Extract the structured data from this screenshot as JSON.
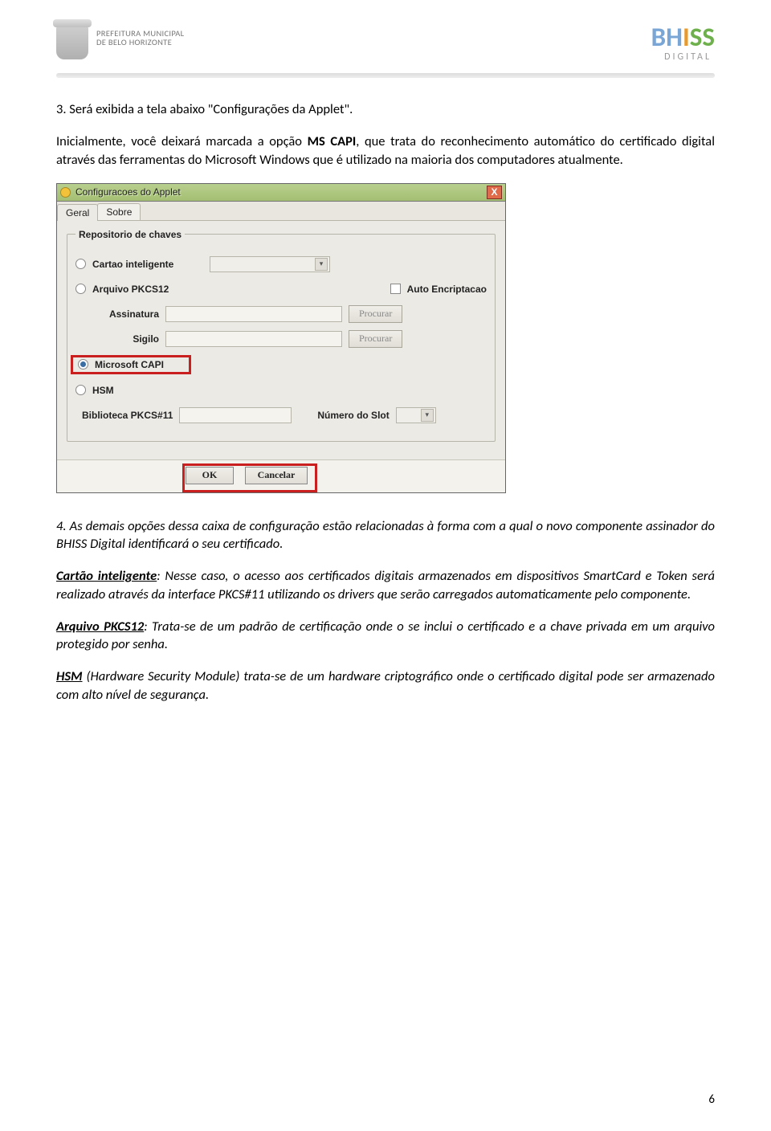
{
  "header": {
    "prefeitura_l1": "PREFEITURA MUNICIPAL",
    "prefeitura_l2": "DE BELO HORIZONTE",
    "bhiss_b": "B",
    "bhiss_h": "H",
    "bhiss_i": "I",
    "bhiss_s1": "S",
    "bhiss_s2": "S",
    "bhiss_sub": "DIGITAL"
  },
  "p3": "3.  Será exibida a tela abaixo \"Configurações da Applet\".",
  "p3b_a": "Inicialmente, você deixará marcada a opção ",
  "p3b_bold": "MS CAPI",
  "p3b_b": ", que trata do reconhecimento automático do certificado digital através das ferramentas do Microsoft Windows que é utilizado na maioria dos computadores atualmente.",
  "p4": "4. As demais opções dessa caixa de configuração estão relacionadas à forma com a qual o novo componente assinador do BHISS Digital identificará o seu certificado.",
  "p_cartao_t": "Cartão inteligente",
  "p_cartao_b": ":  Nesse caso, o acesso aos certificados digitais armazenados em dispositivos SmartCard e Token será realizado através da interface PKCS#11 utilizando os drivers que serão carregados automaticamente pelo componente.",
  "p_pkcs_t": "Arquivo PKCS12",
  "p_pkcs_b": ":  Trata-se de um padrão de certificação onde o se inclui o certificado e a chave privada em um arquivo protegido por senha.",
  "p_hsm_t": "HSM",
  "p_hsm_b": " (Hardware Security Module) trata-se de um hardware criptográfico onde o certificado digital pode ser armazenado com alto nível de segurança.",
  "page_number": "6",
  "win": {
    "title": "Configuracoes do Applet",
    "tab_geral": "Geral",
    "tab_sobre": "Sobre",
    "legend": "Repositorio de chaves",
    "opt_cartao": "Cartao inteligente",
    "opt_pkcs12": "Arquivo PKCS12",
    "chk_auto": "Auto Encriptacao",
    "lbl_assinatura": "Assinatura",
    "lbl_sigilo": "Sigilo",
    "btn_procurar": "Procurar",
    "opt_mscapi": "Microsoft CAPI",
    "opt_hsm": "HSM",
    "lbl_biblioteca": "Biblioteca PKCS#11",
    "lbl_slot": "Número do Slot",
    "btn_ok": "OK",
    "btn_cancelar": "Cancelar"
  }
}
